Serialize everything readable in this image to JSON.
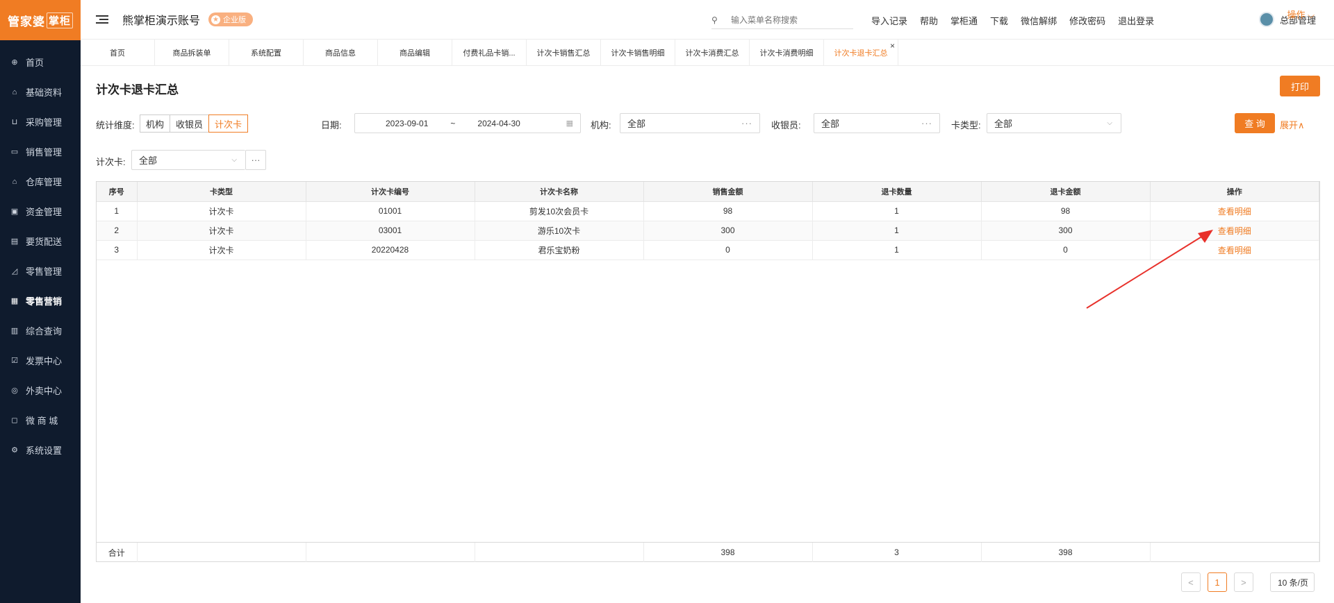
{
  "brand": {
    "logo_main": "管家婆",
    "logo_sub": "掌柜"
  },
  "sidebar": {
    "items": [
      {
        "label": "首页",
        "icon": "globe-icon",
        "glyph": "⊕"
      },
      {
        "label": "基础资料",
        "icon": "home-icon",
        "glyph": "⌂"
      },
      {
        "label": "采购管理",
        "icon": "cart-icon",
        "glyph": "⊔"
      },
      {
        "label": "销售管理",
        "icon": "sales-icon",
        "glyph": "▭"
      },
      {
        "label": "仓库管理",
        "icon": "warehouse-icon",
        "glyph": "⌂"
      },
      {
        "label": "资金管理",
        "icon": "money-icon",
        "glyph": "▣"
      },
      {
        "label": "要货配送",
        "icon": "delivery-icon",
        "glyph": "▤"
      },
      {
        "label": "零售管理",
        "icon": "chart-icon",
        "glyph": "◿"
      },
      {
        "label": "零售营销",
        "icon": "gift-icon",
        "glyph": "▦"
      },
      {
        "label": "综合查询",
        "icon": "bar-chart-icon",
        "glyph": "▥"
      },
      {
        "label": "发票中心",
        "icon": "invoice-icon",
        "glyph": "☑"
      },
      {
        "label": "外卖中心",
        "icon": "takeout-icon",
        "glyph": "◎"
      },
      {
        "label": "微 商 城",
        "icon": "shop-bag-icon",
        "glyph": "◻"
      },
      {
        "label": "系统设置",
        "icon": "gear-icon",
        "glyph": "⚙"
      }
    ]
  },
  "header": {
    "account_name": "熊掌柜演示账号",
    "badge": "企业版",
    "search_placeholder": "输入菜单名称搜索",
    "links": [
      "导入记录",
      "帮助",
      "掌柜通",
      "下载",
      "微信解绑",
      "修改密码",
      "退出登录"
    ],
    "user": "总部管理"
  },
  "tabs": {
    "items": [
      "首页",
      "商品拆装单",
      "系统配置",
      "商品信息",
      "商品编辑",
      "付费礼品卡销...",
      "计次卡销售汇总",
      "计次卡销售明细",
      "计次卡消费汇总",
      "计次卡消费明细",
      "计次卡退卡汇总"
    ],
    "close": "×",
    "ops": "操作 ⌵"
  },
  "page": {
    "title": "计次卡退卡汇总",
    "print": "打印"
  },
  "filters": {
    "dimension_label": "统计维度:",
    "dimension_options": [
      "机构",
      "收银员",
      "计次卡"
    ],
    "date_label": "日期:",
    "date_from": "2023-09-01",
    "date_sep": "~",
    "date_to": "2024-04-30",
    "org_label": "机构:",
    "org_value": "全部",
    "cashier_label": "收银员:",
    "cashier_value": "全部",
    "card_type_label": "卡类型:",
    "card_type_value": "全部",
    "query": "查 询",
    "expand": "展开∧",
    "card_label": "计次卡:",
    "card_value": "全部",
    "more": "···"
  },
  "table": {
    "columns": [
      "序号",
      "卡类型",
      "计次卡编号",
      "计次卡名称",
      "销售金额",
      "退卡数量",
      "退卡金额",
      "操作"
    ],
    "rows": [
      [
        "1",
        "计次卡",
        "01001",
        "剪发10次会员卡",
        "98",
        "1",
        "98",
        "查看明细"
      ],
      [
        "2",
        "计次卡",
        "03001",
        "游乐10次卡",
        "300",
        "1",
        "300",
        "查看明细"
      ],
      [
        "3",
        "计次卡",
        "20220428",
        "君乐宝奶粉",
        "0",
        "1",
        "0",
        "查看明细"
      ]
    ],
    "footer": [
      "合计",
      "",
      "",
      "",
      "398",
      "3",
      "398",
      ""
    ]
  },
  "pagination": {
    "prev": "<",
    "current": "1",
    "next": ">",
    "page_size": "10 条/页"
  }
}
